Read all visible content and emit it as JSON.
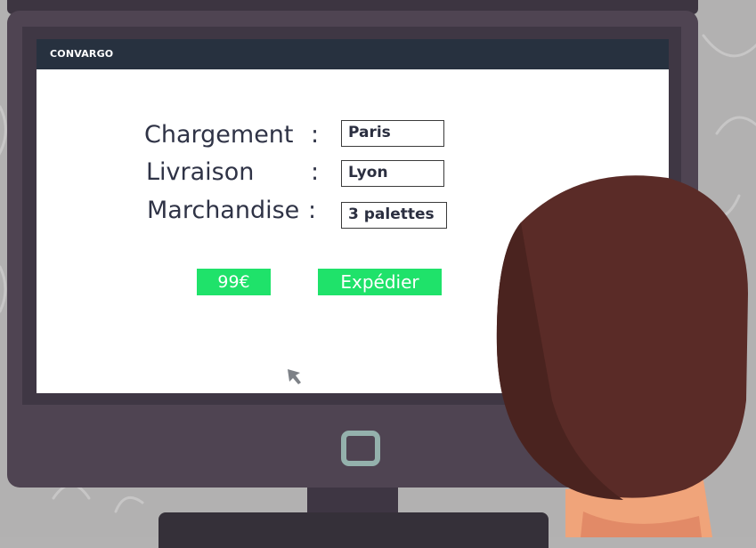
{
  "app": {
    "title": "CONVARGO"
  },
  "form": {
    "loading_label": "Chargement",
    "delivery_label": "Livraison",
    "goods_label": "Marchandise",
    "separator": ":",
    "loading_value": "Paris",
    "delivery_value": "Lyon",
    "goods_value": "3 palettes"
  },
  "actions": {
    "price_label": "99€",
    "ship_label": "Expédier"
  },
  "icons": {
    "cursor": "mouse-pointer-icon",
    "power": "power-button-icon"
  },
  "colors": {
    "app_bar": "#27313f",
    "accent_green": "#1fe26a",
    "monitor_frame": "#4f4452",
    "hair": "#5a2b27"
  }
}
